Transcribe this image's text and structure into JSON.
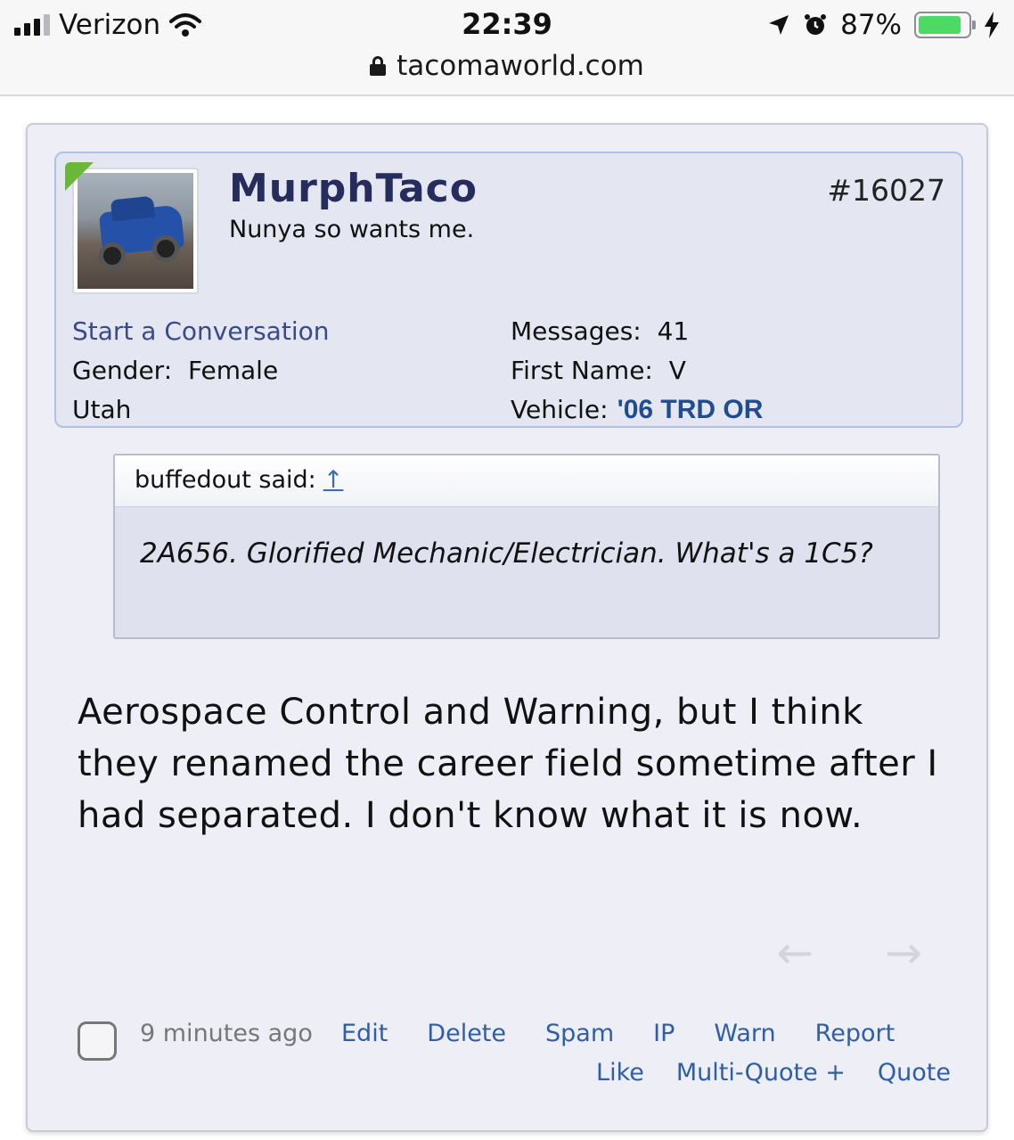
{
  "statusbar": {
    "carrier": "Verizon",
    "time": "22:39",
    "battery_percent": "87%",
    "battery_level": 0.87,
    "url": "tacomaworld.com"
  },
  "post": {
    "username": "MurphTaco",
    "user_title": "Nunya so wants me.",
    "post_number": "#16027",
    "start_conversation": "Start a Conversation",
    "gender_label": "Gender:",
    "gender_value": "Female",
    "location": "Utah",
    "messages_label": "Messages:",
    "messages_value": "41",
    "first_name_label": "First Name:",
    "first_name_value": "V",
    "vehicle_label": "Vehicle:",
    "vehicle_value": "'06 TRD OR",
    "quote": {
      "author": "buffedout said:",
      "jump_arrow": "↑",
      "text": "2A656. Glorified Mechanic/Electrician. What's a 1C5?"
    },
    "message": "Aerospace Control and Warning, but I think they renamed the career field sometime after I had separated. I don't know what it is now.",
    "time_ago": "9 minutes ago",
    "actions_row1": [
      "Edit",
      "Delete",
      "Spam",
      "IP",
      "Warn",
      "Report"
    ],
    "actions_row2": [
      "Like",
      "Multi-Quote +",
      "Quote"
    ],
    "prev_arrow": "←",
    "next_arrow": "→"
  }
}
